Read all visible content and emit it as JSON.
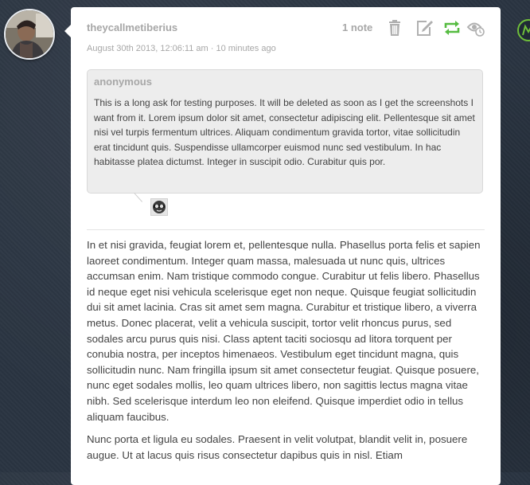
{
  "post": {
    "username": "theycallmetiberius",
    "timestamp": "August 30th 2013, 12:06:11 am · 10 minutes ago",
    "notes": "1 note"
  },
  "controls": {
    "delete_icon": "trash-icon",
    "edit_icon": "edit-icon",
    "reblog_icon": "reblog-icon",
    "reblog_color": "#56bc41",
    "queue_icon": "queue-icon"
  },
  "ask": {
    "asker": "anonymous",
    "question": "This is a long ask for testing purposes. It will be deleted as soon as I get the screenshots I want from it. Lorem ipsum dolor sit amet, consectetur adipiscing elit. Pellentesque sit amet nisi vel turpis fermentum ultrices. Aliquam condimentum gravida tortor, vitae sollicitudin erat tincidunt quis. Suspendisse ullamcorper euismod nunc sed vestibulum. In hac habitasse platea dictumst. Integer in suscipit odio. Curabitur quis por."
  },
  "answer": {
    "paragraphs": [
      "In et nisi gravida, feugiat lorem et, pellentesque nulla. Phasellus porta felis et sapien laoreet condimentum. Integer quam massa, malesuada ut nunc quis, ultrices accumsan enim. Nam tristique commodo congue. Curabitur ut felis libero. Phasellus id neque eget nisi vehicula scelerisque eget non neque. Quisque feugiat sollicitudin dui sit amet lacinia. Cras sit amet sem magna. Curabitur et tristique libero, a viverra metus. Donec placerat, velit a vehicula suscipit, tortor velit rhoncus purus, sed sodales arcu purus quis nisi. Class aptent taciti sociosqu ad litora torquent per conubia nostra, per inceptos himenaeos. Vestibulum eget tincidunt magna, quis sollicitudin nunc. Nam fringilla ipsum sit amet consectetur feugiat. Quisque posuere, nunc eget sodales mollis, leo quam ultrices libero, non sagittis lectus magna vitae nibh. Sed scelerisque interdum leo non eleifend. Quisque imperdiet odio in tellus aliquam faucibus.",
      "Nunc porta et ligula eu sodales. Praesent in velit volutpat, blandit velit in, posuere augue. Ut at lacus quis risus consectetur dapibus quis in nisl. Etiam"
    ]
  }
}
